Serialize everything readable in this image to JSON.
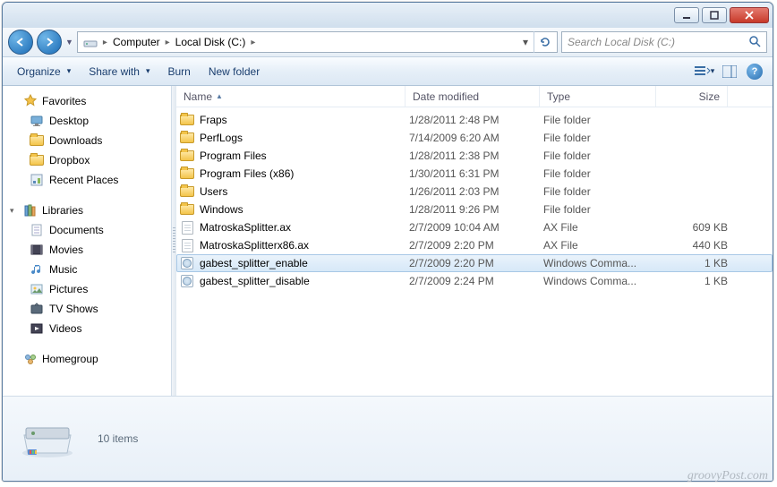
{
  "breadcrumb": {
    "seg1": "Computer",
    "seg2": "Local Disk (C:)"
  },
  "search": {
    "placeholder": "Search Local Disk (C:)"
  },
  "toolbar": {
    "organize": "Organize",
    "share": "Share with",
    "burn": "Burn",
    "newfolder": "New folder"
  },
  "sidebar": {
    "favorites": {
      "label": "Favorites",
      "items": [
        "Desktop",
        "Downloads",
        "Dropbox",
        "Recent Places"
      ]
    },
    "libraries": {
      "label": "Libraries",
      "items": [
        "Documents",
        "Movies",
        "Music",
        "Pictures",
        "TV Shows",
        "Videos"
      ]
    },
    "homegroup": {
      "label": "Homegroup"
    }
  },
  "columns": {
    "name": "Name",
    "date": "Date modified",
    "type": "Type",
    "size": "Size"
  },
  "files": [
    {
      "name": "Fraps",
      "date": "1/28/2011 2:48 PM",
      "type": "File folder",
      "size": "",
      "icon": "folder"
    },
    {
      "name": "PerfLogs",
      "date": "7/14/2009 6:20 AM",
      "type": "File folder",
      "size": "",
      "icon": "folder"
    },
    {
      "name": "Program Files",
      "date": "1/28/2011 2:38 PM",
      "type": "File folder",
      "size": "",
      "icon": "folder"
    },
    {
      "name": "Program Files (x86)",
      "date": "1/30/2011 6:31 PM",
      "type": "File folder",
      "size": "",
      "icon": "folder"
    },
    {
      "name": "Users",
      "date": "1/26/2011 2:03 PM",
      "type": "File folder",
      "size": "",
      "icon": "folder"
    },
    {
      "name": "Windows",
      "date": "1/28/2011 9:26 PM",
      "type": "File folder",
      "size": "",
      "icon": "folder"
    },
    {
      "name": "MatroskaSplitter.ax",
      "date": "2/7/2009 10:04 AM",
      "type": "AX File",
      "size": "609 KB",
      "icon": "file"
    },
    {
      "name": "MatroskaSplitterx86.ax",
      "date": "2/7/2009 2:20 PM",
      "type": "AX File",
      "size": "440 KB",
      "icon": "file"
    },
    {
      "name": "gabest_splitter_enable",
      "date": "2/7/2009 2:20 PM",
      "type": "Windows Comma...",
      "size": "1 KB",
      "icon": "cmd",
      "selected": true
    },
    {
      "name": "gabest_splitter_disable",
      "date": "2/7/2009 2:24 PM",
      "type": "Windows Comma...",
      "size": "1 KB",
      "icon": "cmd"
    }
  ],
  "status": {
    "count": "10 items"
  },
  "watermark": "groovyPost.com"
}
